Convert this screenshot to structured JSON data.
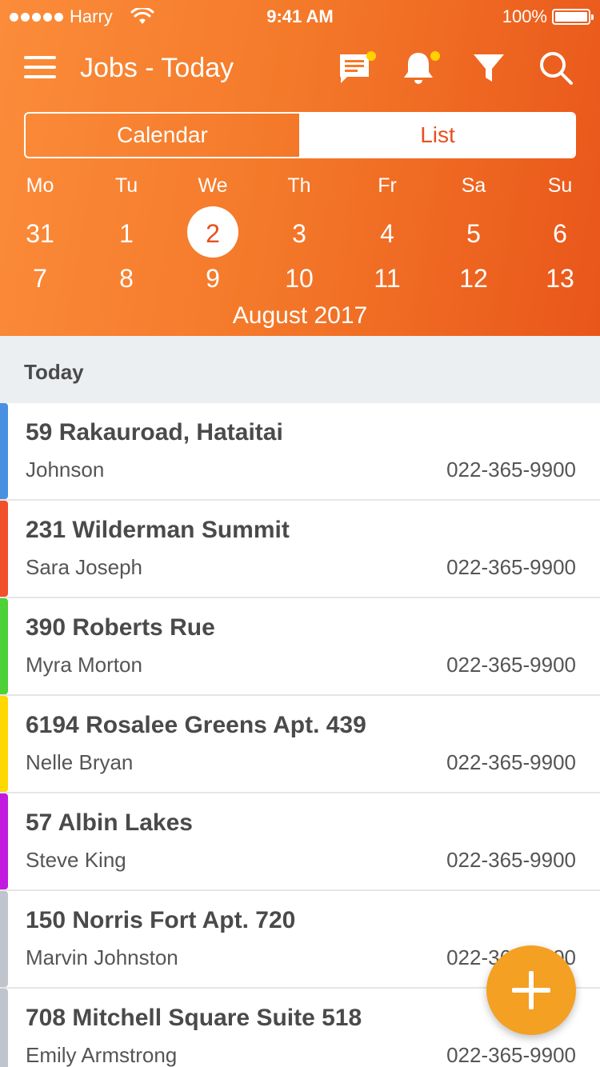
{
  "status_bar": {
    "carrier": "Harry",
    "time": "9:41 AM",
    "battery": "100%",
    "battery_level": 1.0
  },
  "navbar": {
    "title": "Jobs - Today",
    "icons": [
      "menu-icon",
      "chat-icon",
      "bell-icon",
      "filter-icon",
      "search-icon"
    ]
  },
  "segment": {
    "calendar_label": "Calendar",
    "list_label": "List",
    "selected": "List"
  },
  "calendar": {
    "weekdays": [
      "Mo",
      "Tu",
      "We",
      "Th",
      "Fr",
      "Sa",
      "Su"
    ],
    "week1": [
      "31",
      "1",
      "2",
      "3",
      "4",
      "5",
      "6"
    ],
    "week2": [
      "7",
      "8",
      "9",
      "10",
      "11",
      "12",
      "13"
    ],
    "selected_day": "2",
    "month": "August 2017"
  },
  "section": {
    "title": "Today"
  },
  "jobs": [
    {
      "address": "59 Rakauroad, Hataitai",
      "name": "Johnson",
      "phone": "022-365-9900",
      "color": "#4a90e2"
    },
    {
      "address": "231 Wilderman Summit",
      "name": "Sara Joseph",
      "phone": "022-365-9900",
      "color": "#f0502a"
    },
    {
      "address": "390 Roberts Rue",
      "name": "Myra Morton",
      "phone": "022-365-9900",
      "color": "#4cd137"
    },
    {
      "address": "6194 Rosalee Greens Apt. 439",
      "name": "Nelle Bryan",
      "phone": "022-365-9900",
      "color": "#ffd800"
    },
    {
      "address": "57 Albin Lakes",
      "name": "Steve King",
      "phone": "022-365-9900",
      "color": "#c21adf"
    },
    {
      "address": "150 Norris Fort Apt. 720",
      "name": "Marvin Johnston",
      "phone": "022-365-9900",
      "color": "#c0c4cc"
    },
    {
      "address": "708 Mitchell Square Suite 518",
      "name": "Emily Armstrong",
      "phone": "022-365-9900",
      "color": "#c0c4cc"
    }
  ],
  "colors": {
    "accent": "#f47a2a",
    "accent_dark": "#e8501f",
    "fab": "#f4a022",
    "badge": "#ffd200"
  },
  "fab": {
    "icon": "plus-icon"
  }
}
